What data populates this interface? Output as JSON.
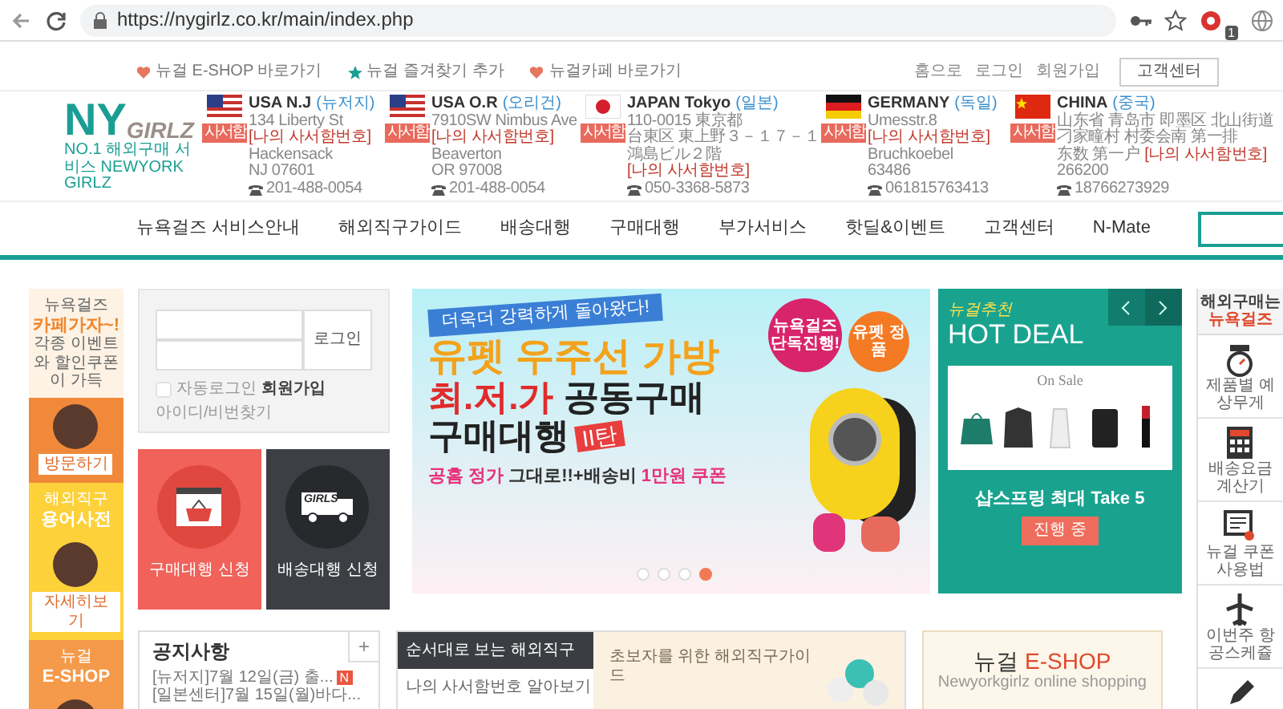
{
  "browser": {
    "url": "https://nygirlz.co.kr/main/index.php",
    "extension_badge": "1"
  },
  "top_links": [
    {
      "text": "뉴걸 E-SHOP 바로가기"
    },
    {
      "text": "뉴걸 즐겨찾기 추가"
    },
    {
      "text": "뉴걸카페 바로가기"
    }
  ],
  "account_links": [
    "홈으로",
    "로그인",
    "회원가입"
  ],
  "support_button": "고객센터",
  "logo": {
    "mark": "NY",
    "name": "GIRLZ",
    "tagline": "NO.1 해외구매 서비스 NEWYORK GIRLZ"
  },
  "warehouses": [
    {
      "name": "USA N.J",
      "local": "(뉴저지)",
      "badge": "사서함",
      "lines": [
        {
          "text": "134 Liberty St"
        },
        {
          "box": "[나의 사서함번호]"
        },
        {
          "text": "Hackensack"
        },
        {
          "text": "NJ 07601"
        }
      ],
      "phone": "201-488-0054"
    },
    {
      "name": "USA O.R",
      "local": "(오리건)",
      "badge": "사서함",
      "lines": [
        {
          "text": "7910SW Nimbus Ave"
        },
        {
          "box": "[나의 사서함번호]"
        },
        {
          "text": "Beaverton"
        },
        {
          "text": "OR 97008"
        }
      ],
      "phone": "201-488-0054"
    },
    {
      "name": "JAPAN Tokyo",
      "local": "(일본)",
      "badge": "사서함",
      "lines": [
        {
          "text": "110-0015 東京都"
        },
        {
          "text": "台東区 東上野３－１７－１"
        },
        {
          "text": "鴻島ビル２階"
        },
        {
          "box": "[나의 사서함번호]"
        }
      ],
      "phone": "050-3368-5873"
    },
    {
      "name": "GERMANY",
      "local": "(독일)",
      "badge": "사서함",
      "lines": [
        {
          "text": "Umesstr.8"
        },
        {
          "box": "[나의 사서함번호]"
        },
        {
          "text": "Bruchkoebel"
        },
        {
          "text": "63486"
        }
      ],
      "phone": "061815763413"
    },
    {
      "name": "CHINA",
      "local": "(중국)",
      "badge": "사서함",
      "lines": [
        {
          "text": "山东省 青岛市 即墨区 北山街道"
        },
        {
          "text": "刁家疃村 村委会南 第一排"
        },
        {
          "text": "东数 第一户",
          "box": "[나의 사서함번호]"
        },
        {
          "text": "266200"
        }
      ],
      "phone": "18766273929"
    }
  ],
  "nav": [
    "뉴욕걸즈 서비스안내",
    "해외직구가이드",
    "배송대행",
    "구매대행",
    "부가서비스",
    "핫딜&이벤트",
    "고객센터",
    "N-Mate"
  ],
  "side_banners": [
    {
      "kind": "cafe",
      "title": "뉴욕걸즈",
      "highlight": "카페가자~!",
      "subtitle": "각종 이벤트와 할인쿠폰이 가득",
      "button": "방문하기"
    },
    {
      "kind": "dictionary",
      "title": "해외직구",
      "highlight": "용어사전",
      "button": "자세히보기"
    },
    {
      "kind": "eshop",
      "title": "뉴걸",
      "highlight": "E-SHOP"
    }
  ],
  "login": {
    "button": "로그인",
    "auto_login": {
      "label": "자동로그인",
      "checked": false
    },
    "links": [
      "회원가입",
      "아이디/비번찾기"
    ]
  },
  "service_tiles": [
    {
      "kind": "purchase",
      "label": "구매대행 신청"
    },
    {
      "kind": "shipping",
      "label": "배송대행 신청",
      "truck_text": "GIRLS"
    }
  ],
  "main_banner": {
    "ribbon": "더욱더 강력하게 돌아왔다!",
    "title": "유펫 우주선 가방",
    "headline": [
      {
        "text": "최.저.가",
        "highlight": true
      },
      {
        "text": "공동구매",
        "highlight": false
      }
    ],
    "subheadline": "구매대행",
    "tag": "II탄",
    "footer": [
      {
        "text": "공홈 정가",
        "highlight": true
      },
      {
        "text": "그대로!!+배송비",
        "highlight": false
      },
      {
        "text": "1만원 쿠폰",
        "highlight": true
      }
    ],
    "stickers": [
      "뉴욕걸즈 단독진행!",
      "유펫 정품"
    ],
    "slides": [
      {
        "selected": false
      },
      {
        "selected": false
      },
      {
        "selected": false
      },
      {
        "selected": true
      }
    ]
  },
  "hot_deal": {
    "kicker": "뉴걸추천",
    "title": "HOT DEAL",
    "panel_title": "On Sale",
    "caption": "샵스프링 최대 Take 5",
    "button": "진행 중"
  },
  "quick_menu": {
    "title": "해외구매는",
    "brand": "뉴욕걸즈",
    "items": [
      {
        "label": "제품별 예상무게"
      },
      {
        "label": "배송요금 계산기"
      },
      {
        "label": "뉴걸 쿠폰사용법"
      },
      {
        "label": "이번주 항공스케쥴"
      }
    ]
  },
  "notice": {
    "title": "공지사항",
    "more": "+",
    "items": [
      {
        "text": "[뉴저지]7월 12일(금) 출...",
        "badge": "N"
      },
      {
        "text": "[일본센터]7월 15일(월)바다..."
      }
    ]
  },
  "guide": {
    "tabs": [
      {
        "label": "순서대로 보는 해외직구",
        "selected": true
      },
      {
        "label": "나의 사서함번호 알아보기",
        "selected": false
      }
    ],
    "banner_text": "초보자를 위한 해외직구가이드"
  },
  "eshop": {
    "title": [
      {
        "text": "뉴걸",
        "highlight": false
      },
      {
        "text": "E-SHOP",
        "highlight": true
      }
    ],
    "subtitle": "Newyorkgirlz online shopping"
  }
}
